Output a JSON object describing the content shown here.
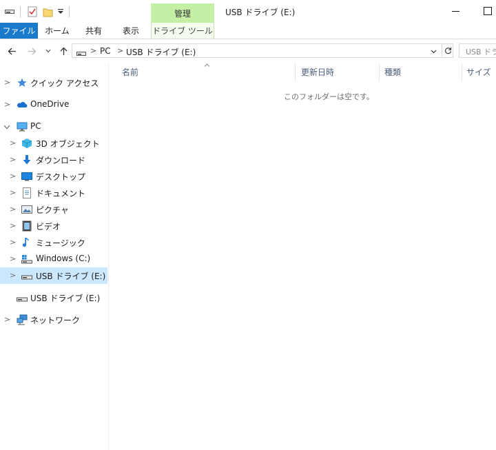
{
  "window": {
    "title": "USB ドライブ (E:)",
    "context_tab_title": "管理"
  },
  "ribbon": {
    "tabs": [
      {
        "label": "ファイル"
      },
      {
        "label": "ホーム"
      },
      {
        "label": "共有"
      },
      {
        "label": "表示"
      },
      {
        "label": "ドライブ ツール"
      }
    ]
  },
  "address": {
    "breadcrumbs": [
      "PC",
      "USB ドライブ (E:)"
    ],
    "search_placeholder": "USB ドライブ (E:)の検索"
  },
  "nav_pane": {
    "items": [
      {
        "label": "クイック アクセス",
        "icon": "star-icon"
      },
      {
        "label": "OneDrive",
        "icon": "cloud-icon"
      },
      {
        "label": "PC",
        "icon": "monitor-icon"
      },
      {
        "label": "3D オブジェクト",
        "icon": "cube-icon"
      },
      {
        "label": "ダウンロード",
        "icon": "download-arrow-icon"
      },
      {
        "label": "デスクトップ",
        "icon": "desktop-icon"
      },
      {
        "label": "ドキュメント",
        "icon": "document-icon"
      },
      {
        "label": "ピクチャ",
        "icon": "picture-icon"
      },
      {
        "label": "ビデオ",
        "icon": "video-icon"
      },
      {
        "label": "ミュージック",
        "icon": "music-note-icon"
      },
      {
        "label": "Windows (C:)",
        "icon": "windows-drive-icon"
      },
      {
        "label": "USB ドライブ (E:)",
        "icon": "usb-drive-icon"
      },
      {
        "label": "USB ドライブ (E:)",
        "icon": "usb-drive-icon"
      },
      {
        "label": "ネットワーク",
        "icon": "network-icon"
      }
    ]
  },
  "content": {
    "columns": [
      {
        "label": "名前"
      },
      {
        "label": "更新日時"
      },
      {
        "label": "種類"
      },
      {
        "label": "サイズ"
      }
    ],
    "empty_message": "このフォルダーは空です。"
  },
  "colors": {
    "file_tab": "#1979ca",
    "context_tab": "#c6efa6",
    "selection": "#cce8ff"
  }
}
